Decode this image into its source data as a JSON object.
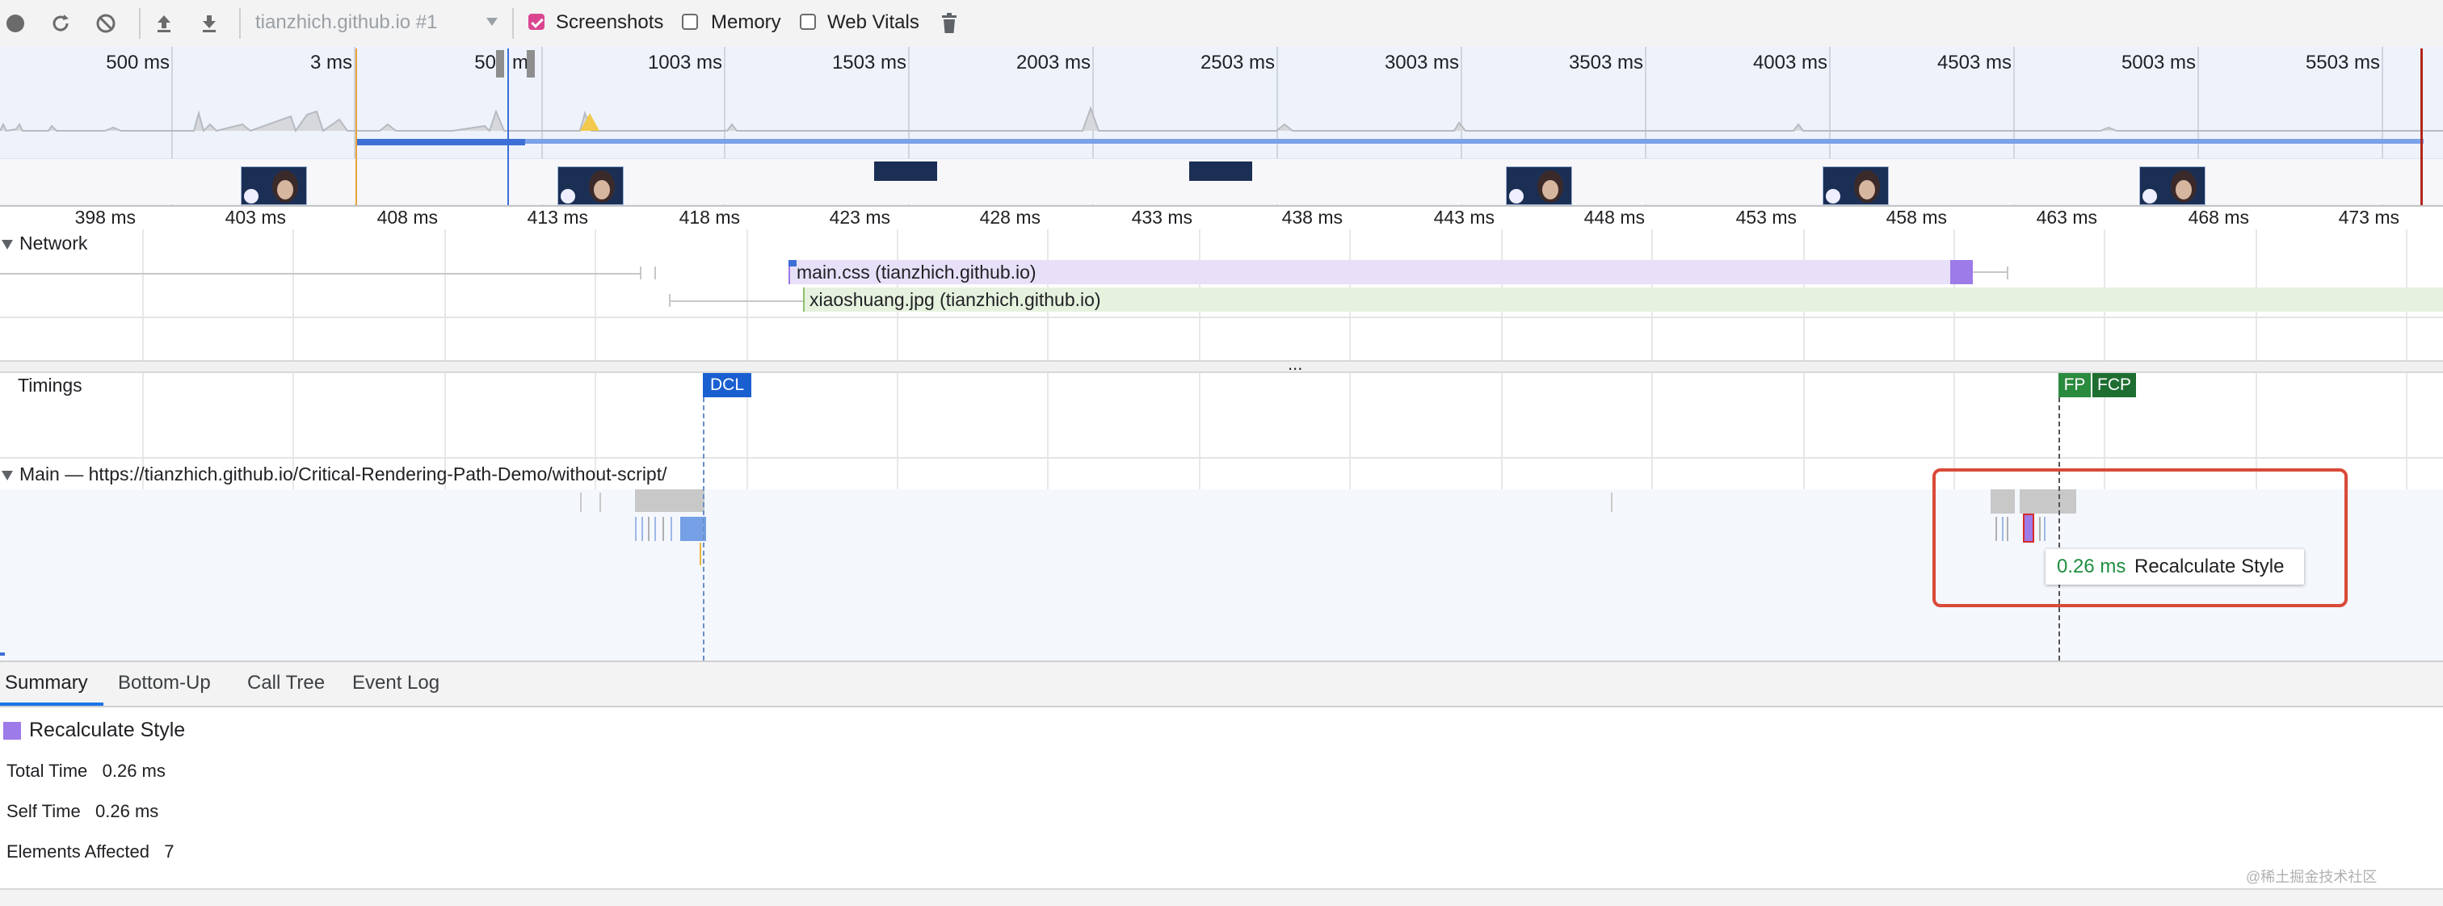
{
  "toolbar": {
    "recording_target": "tianzhich.github.io #1",
    "checkboxes": [
      {
        "label": "Screenshots",
        "checked": true
      },
      {
        "label": "Memory",
        "checked": false
      },
      {
        "label": "Web Vitals",
        "checked": false
      }
    ]
  },
  "overview": {
    "tick_labels": [
      "500 ms",
      "3 ms",
      "50",
      "m",
      "1003 ms",
      "1503 ms",
      "2003 ms",
      "2503 ms",
      "3003 ms",
      "3503 ms",
      "4003 ms",
      "4503 ms",
      "5003 ms",
      "5503 ms"
    ]
  },
  "ruler": {
    "labels": [
      "398 ms",
      "403 ms",
      "408 ms",
      "413 ms",
      "418 ms",
      "423 ms",
      "428 ms",
      "433 ms",
      "438 ms",
      "443 ms",
      "448 ms",
      "453 ms",
      "458 ms",
      "463 ms",
      "468 ms",
      "473 ms"
    ]
  },
  "network": {
    "title": "Network",
    "requests": [
      {
        "label": "main.css (tianzhich.github.io)",
        "color": "#e8e0f8"
      },
      {
        "label": "xiaoshuang.jpg (tianzhich.github.io)",
        "color": "#e6f2de"
      }
    ]
  },
  "more_indicator": "...",
  "timings": {
    "title": "Timings",
    "markers": [
      {
        "label": "DCL",
        "color": "#1a5fd0"
      },
      {
        "label": "FP",
        "color": "#2a8a3e"
      },
      {
        "label": "FCP",
        "color": "#1e6e31"
      }
    ]
  },
  "main_thread": {
    "title": "Main — https://tianzhich.github.io/Critical-Rendering-Path-Demo/without-script/",
    "tooltip": {
      "time": "0.26 ms",
      "label": "Recalculate Style"
    }
  },
  "tabs": [
    "Summary",
    "Bottom-Up",
    "Call Tree",
    "Event Log"
  ],
  "summary": {
    "title": "Recalculate Style",
    "swatch_color": "#9d7be8",
    "rows": [
      {
        "label": "Total Time",
        "value": "0.26 ms"
      },
      {
        "label": "Self Time",
        "value": "0.26 ms"
      },
      {
        "label": "Elements Affected",
        "value": "7"
      }
    ]
  },
  "watermark": "@稀土掘金技术社区"
}
